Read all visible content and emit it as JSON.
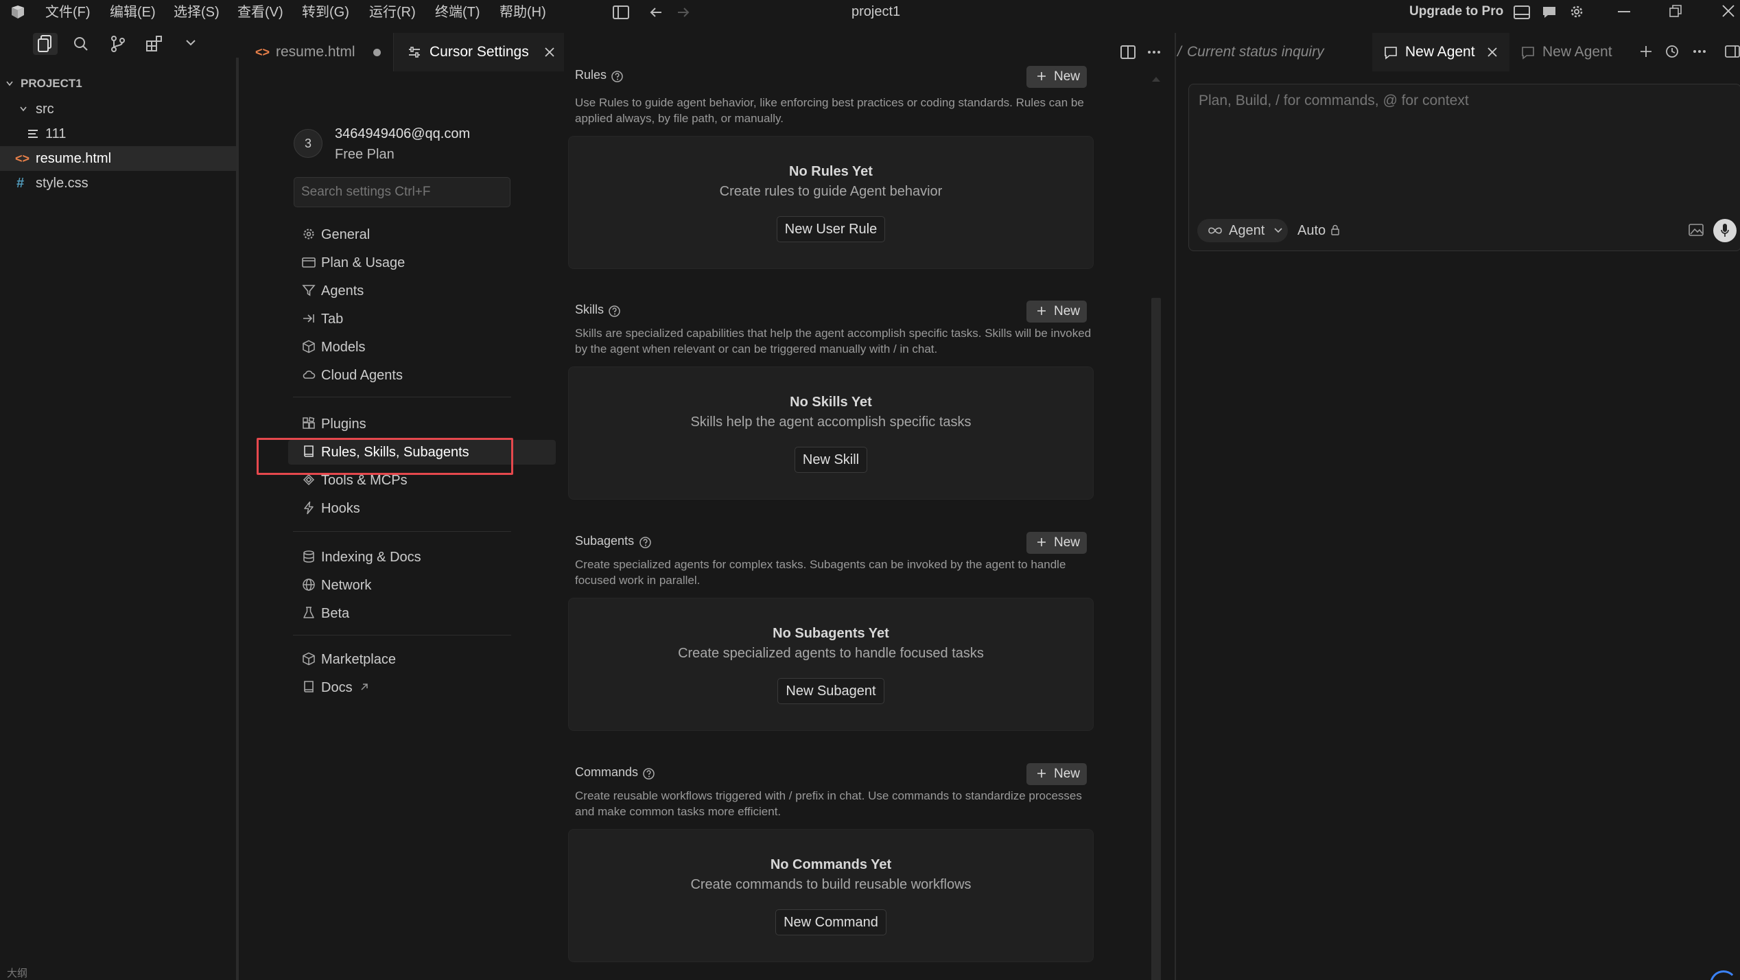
{
  "titlebar": {
    "menus": [
      "文件(F)",
      "编辑(E)",
      "选择(S)",
      "查看(V)",
      "转到(G)",
      "运行(R)",
      "终端(T)",
      "帮助(H)"
    ],
    "project_title": "project1",
    "upgrade_label": "Upgrade to Pro"
  },
  "explorer": {
    "root_label": "PROJECT1",
    "items": [
      {
        "label": "src"
      },
      {
        "label": "111"
      },
      {
        "label": "resume.html"
      },
      {
        "label": "style.css"
      }
    ],
    "bottom_label": "大纲"
  },
  "tabs": [
    {
      "label": "resume.html"
    },
    {
      "label": "Cursor Settings"
    }
  ],
  "account": {
    "avatar_letter": "3",
    "email": "3464949406@qq.com",
    "plan": "Free Plan"
  },
  "search": {
    "placeholder": "Search settings Ctrl+F"
  },
  "nav": {
    "groups": [
      [
        {
          "label": "General",
          "icon": "gear-icon"
        },
        {
          "label": "Plan & Usage",
          "icon": "card-icon"
        },
        {
          "label": "Agents",
          "icon": "agent-icon"
        },
        {
          "label": "Tab",
          "icon": "tab-icon"
        },
        {
          "label": "Models",
          "icon": "cube-icon"
        },
        {
          "label": "Cloud Agents",
          "icon": "cloud-icon"
        }
      ],
      [
        {
          "label": "Plugins",
          "icon": "plugin-icon"
        },
        {
          "label": "Rules, Skills, Subagents",
          "icon": "book-icon"
        },
        {
          "label": "Tools & MCPs",
          "icon": "tools-icon"
        },
        {
          "label": "Hooks",
          "icon": "bolt-icon"
        }
      ],
      [
        {
          "label": "Indexing & Docs",
          "icon": "database-icon"
        },
        {
          "label": "Network",
          "icon": "globe-icon"
        },
        {
          "label": "Beta",
          "icon": "flask-icon"
        }
      ],
      [
        {
          "label": "Marketplace",
          "icon": "cube-icon"
        },
        {
          "label": "Docs",
          "icon": "book-icon"
        }
      ]
    ]
  },
  "sections": [
    {
      "title": "Rules",
      "new_label": "New",
      "description": "Use Rules to guide agent behavior, like enforcing best practices or coding standards. Rules can be applied always, by file path, or manually.",
      "empty_title": "No Rules Yet",
      "empty_sub": "Create rules to guide Agent behavior",
      "action": "New User Rule"
    },
    {
      "title": "Skills",
      "new_label": "New",
      "description": "Skills are specialized capabilities that help the agent accomplish specific tasks. Skills will be invoked by the agent when relevant or can be triggered manually with / in chat.",
      "empty_title": "No Skills Yet",
      "empty_sub": "Skills help the agent accomplish specific tasks",
      "action": "New Skill"
    },
    {
      "title": "Subagents",
      "new_label": "New",
      "description": "Create specialized agents for complex tasks. Subagents can be invoked by the agent to handle focused work in parallel.",
      "empty_title": "No Subagents Yet",
      "empty_sub": "Create specialized agents to handle focused tasks",
      "action": "New Subagent"
    },
    {
      "title": "Commands",
      "new_label": "New",
      "description": "Create reusable workflows triggered with / prefix in chat. Use commands to standardize processes and make common tasks more efficient.",
      "empty_title": "No Commands Yet",
      "empty_sub": "Create commands to build reusable workflows",
      "action": "New Command"
    }
  ],
  "agent_panel": {
    "tabs": [
      {
        "label": "Current status inquiry"
      },
      {
        "label": "New Agent"
      },
      {
        "label": "New Agent"
      }
    ],
    "prompt_placeholder": "Plan, Build, / for commands, @ for context",
    "mode_label": "Agent",
    "model_label": "Auto"
  },
  "colors": {
    "background": "#181818",
    "highlight_box": "#e5484d",
    "selected_row": "#2a2a2a"
  }
}
